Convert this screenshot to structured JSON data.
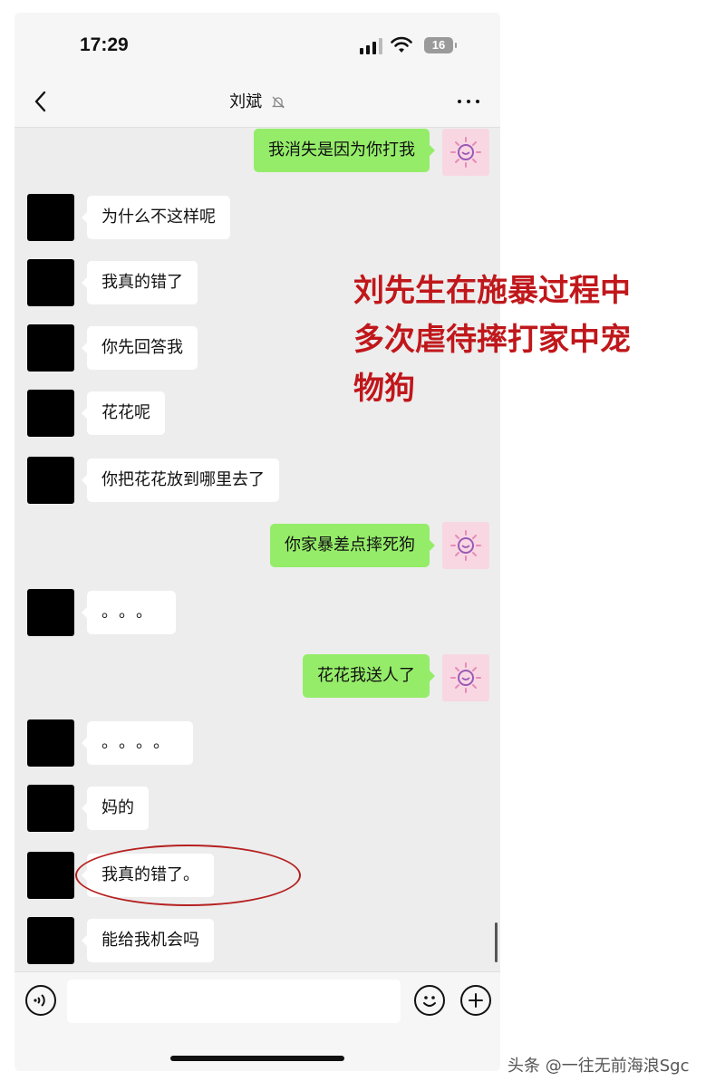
{
  "status_bar": {
    "time": "17:29",
    "battery": "16"
  },
  "header": {
    "title": "刘斌"
  },
  "messages": [
    {
      "side": "out",
      "text": "我消失是因为你打我"
    },
    {
      "side": "in",
      "text": "为什么不这样呢"
    },
    {
      "side": "in",
      "text": "我真的错了"
    },
    {
      "side": "in",
      "text": "你先回答我"
    },
    {
      "side": "in",
      "text": "花花呢"
    },
    {
      "side": "in",
      "text": "你把花花放到哪里去了"
    },
    {
      "side": "out",
      "text": "你家暴差点摔死狗"
    },
    {
      "side": "in",
      "text": "。。。"
    },
    {
      "side": "out",
      "text": "花花我送人了"
    },
    {
      "side": "in",
      "text": "。。。。"
    },
    {
      "side": "in",
      "text": "妈的"
    },
    {
      "side": "in",
      "text": "我真的错了。"
    },
    {
      "side": "in",
      "text": "能给我机会吗"
    }
  ],
  "annotation": {
    "lines": [
      "刘先生在施暴过程中",
      "多次虐待摔打家中宠",
      "物狗"
    ],
    "color": "#c0171b"
  },
  "watermark": "头条 @一往无前海浪Sgc",
  "colors": {
    "out_bubble": "#95ec69",
    "in_bubble": "#ffffff",
    "chat_bg": "#ededed"
  }
}
